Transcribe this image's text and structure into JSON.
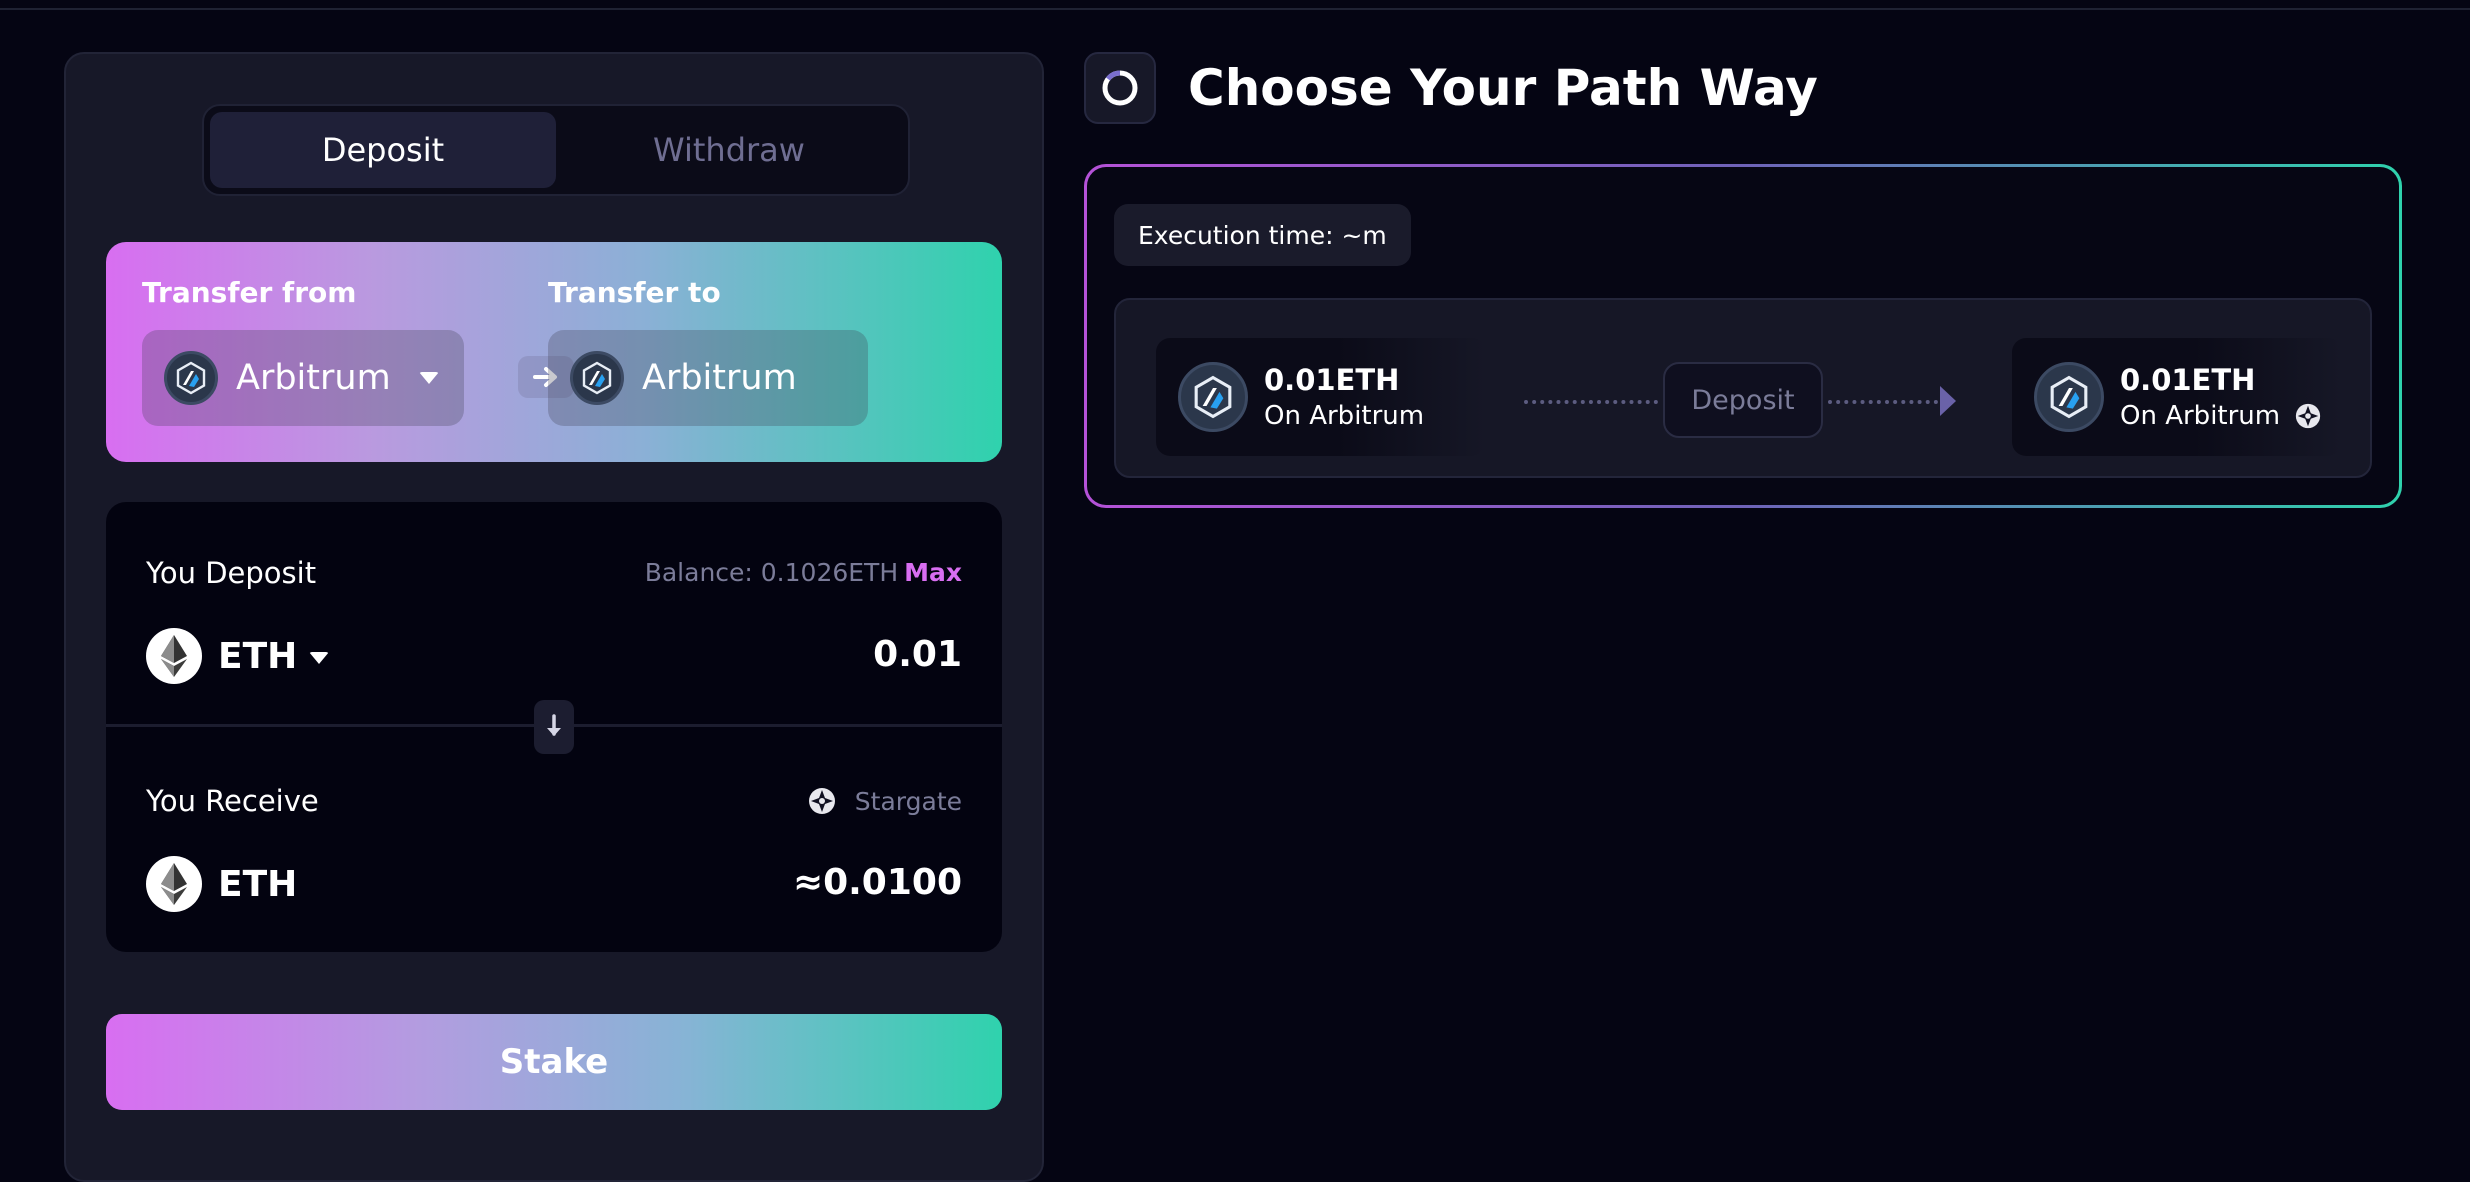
{
  "tabs": {
    "deposit": "Deposit",
    "withdraw": "Withdraw"
  },
  "transfer": {
    "from_label": "Transfer from",
    "to_label": "Transfer to",
    "from_chain": "Arbitrum",
    "to_chain": "Arbitrum"
  },
  "deposit": {
    "title": "You Deposit",
    "balance_label": "Balance: 0.1026ETH",
    "max_label": "Max",
    "token": "ETH",
    "amount": "0.01"
  },
  "receive": {
    "title": "You Receive",
    "route_name": "Stargate",
    "token": "ETH",
    "amount": "≈0.0100"
  },
  "stake_button": "Stake",
  "path": {
    "title": "Choose Your Path Way",
    "execution_time": "Execution time: ~m",
    "source": {
      "amount": "0.01ETH",
      "chain": "On Arbitrum"
    },
    "step_label": "Deposit",
    "destination": {
      "amount": "0.01ETH",
      "chain": "On Arbitrum"
    }
  },
  "colors": {
    "accent_pink": "#d86ef1",
    "accent_teal": "#2fd2ad",
    "panel_bg": "#171828",
    "page_bg": "#050513"
  },
  "icons": [
    "arbitrum-logo",
    "ethereum-logo",
    "stargate-icon",
    "arrow-right-icon",
    "arrow-down-icon",
    "chevron-down-icon",
    "path-spinner-icon"
  ]
}
